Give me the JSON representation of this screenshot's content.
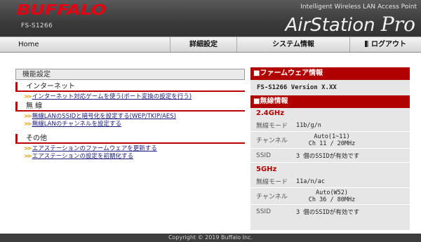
{
  "header": {
    "logo": "BUFFALO",
    "model": "FS-S1266",
    "tagline": "Intelligent Wireless LAN Access Point",
    "brand": "AirStation",
    "brand_suffix": "Pro"
  },
  "nav": {
    "home": "Home",
    "detail": "詳細設定",
    "system": "システム情報",
    "logout": "ログアウト"
  },
  "left": {
    "title": "機能設定",
    "sections": [
      {
        "title": "インターネット",
        "links": [
          "インターネット対応ゲームを使う(ポート変換の設定を行う)"
        ]
      },
      {
        "title": "無 線",
        "links": [
          "無線LANのSSIDと暗号化を設定する(WEP/TKIP/AES)",
          "無線LANのチャンネルを設定する"
        ]
      },
      {
        "title": "その他",
        "links": [
          "エアステーションのファームウェアを更新する",
          "エアステーションの設定を初期化する"
        ]
      }
    ]
  },
  "right": {
    "firmware_title": "■ファームウェア情報",
    "firmware_value": "FS-S1266 Version X.XX",
    "wireless_title": "■無線情報",
    "bands": [
      {
        "name": "2.4GHz",
        "mode_label": "無線モード",
        "mode": "11b/g/n",
        "channel_label": "チャンネル",
        "channel_1": "Auto(1~11)",
        "channel_2": "Ch 11 / 20MHz",
        "ssid_label": "SSID",
        "ssid": "3 個のSSIDが有効です"
      },
      {
        "name": "5GHz",
        "mode_label": "無線モード",
        "mode": "11a/n/ac",
        "channel_label": "チャンネル",
        "channel_1": "Auto(W52)",
        "channel_2": "Ch 36 / 80MHz",
        "ssid_label": "SSID",
        "ssid": "3 個のSSIDが有効です"
      }
    ]
  },
  "footer": {
    "copyright": "Copyright © 2019 Buffalo Inc."
  },
  "colors": {
    "accent": "#b10000",
    "header_bg": "#3b3b3b",
    "link": "#1a1a80"
  }
}
